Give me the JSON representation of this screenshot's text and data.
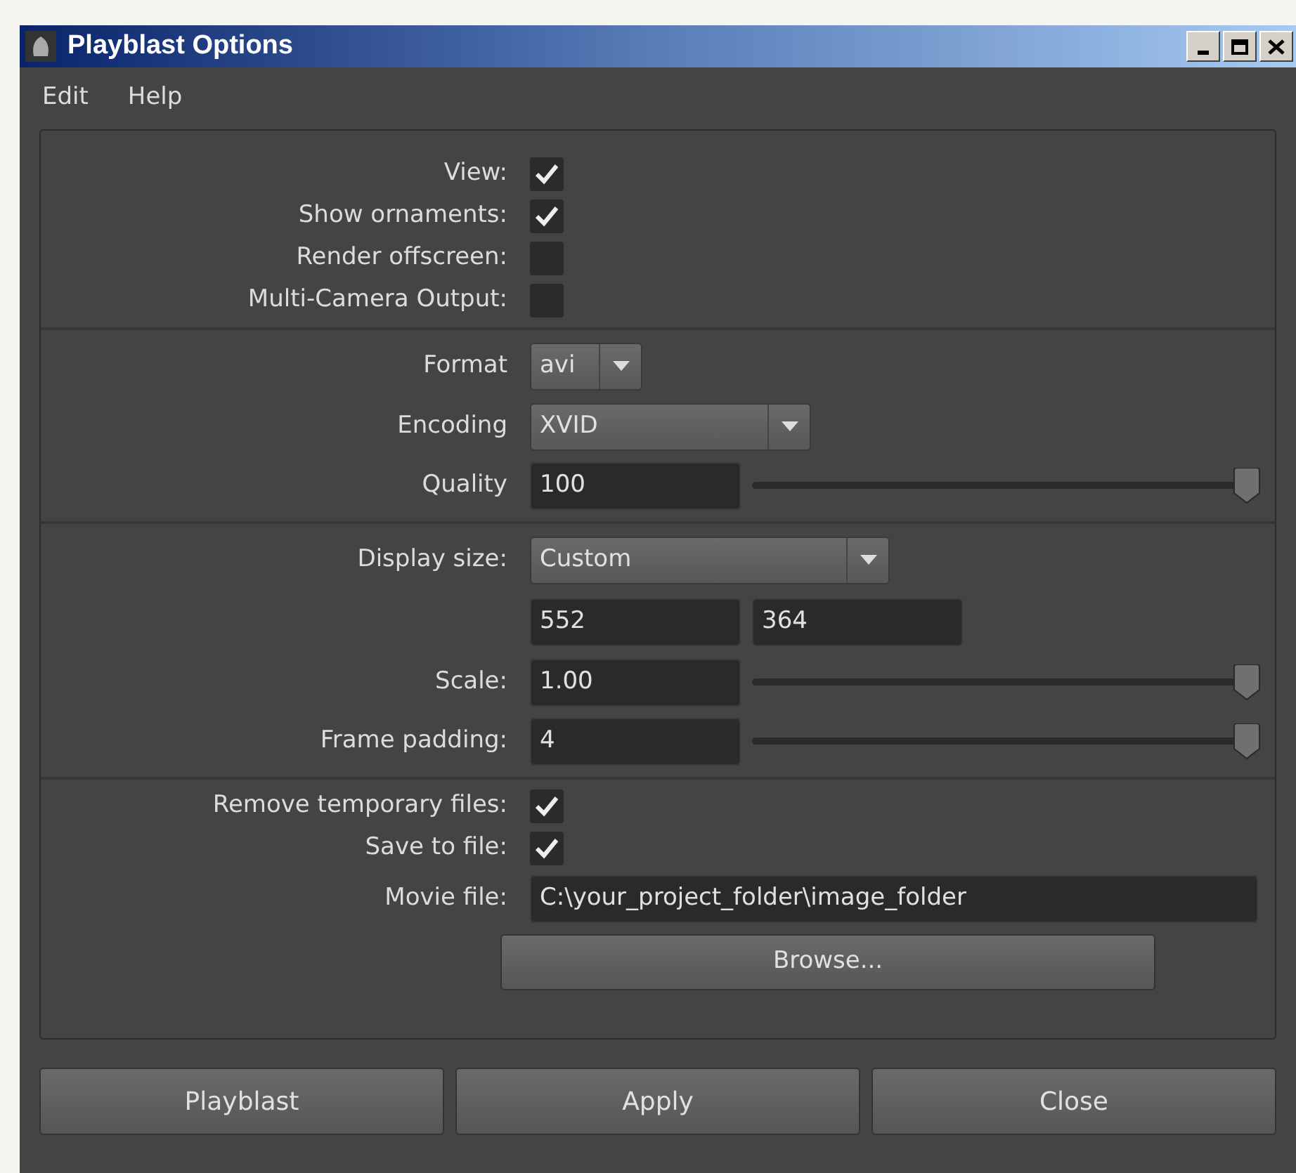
{
  "window": {
    "title": "Playblast Options"
  },
  "menu": [
    "Edit",
    "Help"
  ],
  "sections": [
    [
      {
        "kind": "checkbox",
        "label": "View:",
        "checked": true
      },
      {
        "kind": "checkbox",
        "label": "Show ornaments:",
        "checked": true
      },
      {
        "kind": "checkbox",
        "label": "Render offscreen:",
        "checked": false
      },
      {
        "kind": "checkbox",
        "label": "Multi-Camera Output:",
        "checked": false
      }
    ],
    [
      {
        "kind": "dropdown",
        "label": "Format",
        "value": "avi"
      },
      {
        "kind": "dropdown",
        "label": "Encoding",
        "value": "XVID"
      },
      {
        "kind": "slider",
        "label": "Quality",
        "value": "100",
        "level": 1
      }
    ],
    [
      {
        "kind": "dropdown",
        "label": "Display size:",
        "value": "Custom"
      },
      {
        "kind": "pair",
        "values": [
          "552",
          "364"
        ]
      },
      {
        "kind": "slider",
        "label": "Scale:",
        "value": "1.00",
        "level": 1
      },
      {
        "kind": "slider",
        "label": "Frame padding:",
        "value": "4",
        "level": 1
      }
    ],
    [
      {
        "kind": "checkbox",
        "label": "Remove temporary files:",
        "checked": true
      },
      {
        "kind": "checkbox",
        "label": "Save to file:",
        "checked": true
      },
      {
        "kind": "text",
        "label": "Movie file:",
        "value": "C:\\your_project_folder\\image_folder"
      },
      {
        "kind": "button",
        "label": "Browse..."
      }
    ]
  ],
  "buttons": [
    "Playblast",
    "Apply",
    "Close"
  ]
}
